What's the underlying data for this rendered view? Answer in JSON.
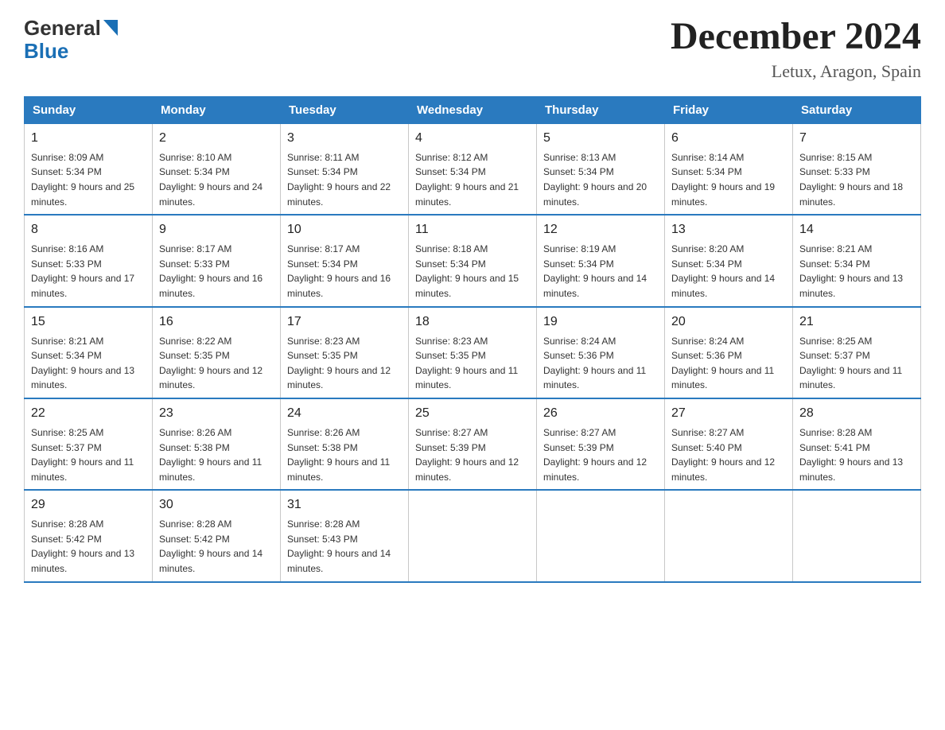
{
  "logo": {
    "general": "General",
    "blue": "Blue",
    "arrow_color": "#1a6fb5"
  },
  "header": {
    "month_year": "December 2024",
    "location": "Letux, Aragon, Spain"
  },
  "weekdays": [
    "Sunday",
    "Monday",
    "Tuesday",
    "Wednesday",
    "Thursday",
    "Friday",
    "Saturday"
  ],
  "weeks": [
    [
      {
        "day": "1",
        "sunrise": "Sunrise: 8:09 AM",
        "sunset": "Sunset: 5:34 PM",
        "daylight": "Daylight: 9 hours and 25 minutes."
      },
      {
        "day": "2",
        "sunrise": "Sunrise: 8:10 AM",
        "sunset": "Sunset: 5:34 PM",
        "daylight": "Daylight: 9 hours and 24 minutes."
      },
      {
        "day": "3",
        "sunrise": "Sunrise: 8:11 AM",
        "sunset": "Sunset: 5:34 PM",
        "daylight": "Daylight: 9 hours and 22 minutes."
      },
      {
        "day": "4",
        "sunrise": "Sunrise: 8:12 AM",
        "sunset": "Sunset: 5:34 PM",
        "daylight": "Daylight: 9 hours and 21 minutes."
      },
      {
        "day": "5",
        "sunrise": "Sunrise: 8:13 AM",
        "sunset": "Sunset: 5:34 PM",
        "daylight": "Daylight: 9 hours and 20 minutes."
      },
      {
        "day": "6",
        "sunrise": "Sunrise: 8:14 AM",
        "sunset": "Sunset: 5:34 PM",
        "daylight": "Daylight: 9 hours and 19 minutes."
      },
      {
        "day": "7",
        "sunrise": "Sunrise: 8:15 AM",
        "sunset": "Sunset: 5:33 PM",
        "daylight": "Daylight: 9 hours and 18 minutes."
      }
    ],
    [
      {
        "day": "8",
        "sunrise": "Sunrise: 8:16 AM",
        "sunset": "Sunset: 5:33 PM",
        "daylight": "Daylight: 9 hours and 17 minutes."
      },
      {
        "day": "9",
        "sunrise": "Sunrise: 8:17 AM",
        "sunset": "Sunset: 5:33 PM",
        "daylight": "Daylight: 9 hours and 16 minutes."
      },
      {
        "day": "10",
        "sunrise": "Sunrise: 8:17 AM",
        "sunset": "Sunset: 5:34 PM",
        "daylight": "Daylight: 9 hours and 16 minutes."
      },
      {
        "day": "11",
        "sunrise": "Sunrise: 8:18 AM",
        "sunset": "Sunset: 5:34 PM",
        "daylight": "Daylight: 9 hours and 15 minutes."
      },
      {
        "day": "12",
        "sunrise": "Sunrise: 8:19 AM",
        "sunset": "Sunset: 5:34 PM",
        "daylight": "Daylight: 9 hours and 14 minutes."
      },
      {
        "day": "13",
        "sunrise": "Sunrise: 8:20 AM",
        "sunset": "Sunset: 5:34 PM",
        "daylight": "Daylight: 9 hours and 14 minutes."
      },
      {
        "day": "14",
        "sunrise": "Sunrise: 8:21 AM",
        "sunset": "Sunset: 5:34 PM",
        "daylight": "Daylight: 9 hours and 13 minutes."
      }
    ],
    [
      {
        "day": "15",
        "sunrise": "Sunrise: 8:21 AM",
        "sunset": "Sunset: 5:34 PM",
        "daylight": "Daylight: 9 hours and 13 minutes."
      },
      {
        "day": "16",
        "sunrise": "Sunrise: 8:22 AM",
        "sunset": "Sunset: 5:35 PM",
        "daylight": "Daylight: 9 hours and 12 minutes."
      },
      {
        "day": "17",
        "sunrise": "Sunrise: 8:23 AM",
        "sunset": "Sunset: 5:35 PM",
        "daylight": "Daylight: 9 hours and 12 minutes."
      },
      {
        "day": "18",
        "sunrise": "Sunrise: 8:23 AM",
        "sunset": "Sunset: 5:35 PM",
        "daylight": "Daylight: 9 hours and 11 minutes."
      },
      {
        "day": "19",
        "sunrise": "Sunrise: 8:24 AM",
        "sunset": "Sunset: 5:36 PM",
        "daylight": "Daylight: 9 hours and 11 minutes."
      },
      {
        "day": "20",
        "sunrise": "Sunrise: 8:24 AM",
        "sunset": "Sunset: 5:36 PM",
        "daylight": "Daylight: 9 hours and 11 minutes."
      },
      {
        "day": "21",
        "sunrise": "Sunrise: 8:25 AM",
        "sunset": "Sunset: 5:37 PM",
        "daylight": "Daylight: 9 hours and 11 minutes."
      }
    ],
    [
      {
        "day": "22",
        "sunrise": "Sunrise: 8:25 AM",
        "sunset": "Sunset: 5:37 PM",
        "daylight": "Daylight: 9 hours and 11 minutes."
      },
      {
        "day": "23",
        "sunrise": "Sunrise: 8:26 AM",
        "sunset": "Sunset: 5:38 PM",
        "daylight": "Daylight: 9 hours and 11 minutes."
      },
      {
        "day": "24",
        "sunrise": "Sunrise: 8:26 AM",
        "sunset": "Sunset: 5:38 PM",
        "daylight": "Daylight: 9 hours and 11 minutes."
      },
      {
        "day": "25",
        "sunrise": "Sunrise: 8:27 AM",
        "sunset": "Sunset: 5:39 PM",
        "daylight": "Daylight: 9 hours and 12 minutes."
      },
      {
        "day": "26",
        "sunrise": "Sunrise: 8:27 AM",
        "sunset": "Sunset: 5:39 PM",
        "daylight": "Daylight: 9 hours and 12 minutes."
      },
      {
        "day": "27",
        "sunrise": "Sunrise: 8:27 AM",
        "sunset": "Sunset: 5:40 PM",
        "daylight": "Daylight: 9 hours and 12 minutes."
      },
      {
        "day": "28",
        "sunrise": "Sunrise: 8:28 AM",
        "sunset": "Sunset: 5:41 PM",
        "daylight": "Daylight: 9 hours and 13 minutes."
      }
    ],
    [
      {
        "day": "29",
        "sunrise": "Sunrise: 8:28 AM",
        "sunset": "Sunset: 5:42 PM",
        "daylight": "Daylight: 9 hours and 13 minutes."
      },
      {
        "day": "30",
        "sunrise": "Sunrise: 8:28 AM",
        "sunset": "Sunset: 5:42 PM",
        "daylight": "Daylight: 9 hours and 14 minutes."
      },
      {
        "day": "31",
        "sunrise": "Sunrise: 8:28 AM",
        "sunset": "Sunset: 5:43 PM",
        "daylight": "Daylight: 9 hours and 14 minutes."
      },
      null,
      null,
      null,
      null
    ]
  ]
}
